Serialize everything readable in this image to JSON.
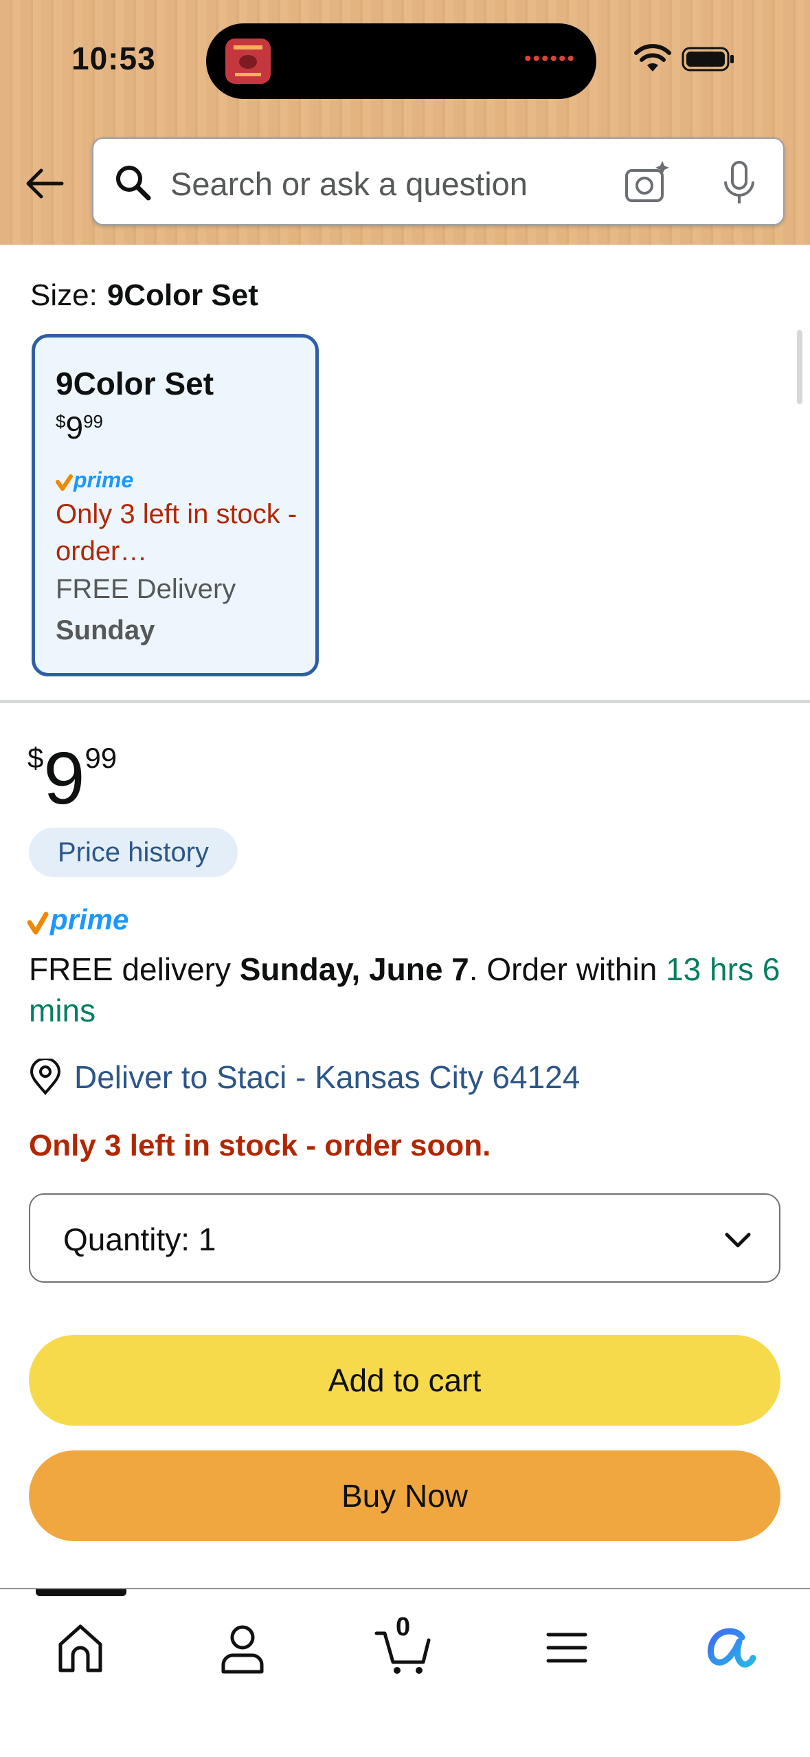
{
  "status_bar": {
    "time": "10:53"
  },
  "search": {
    "placeholder": "Search or ask a question"
  },
  "size": {
    "label": "Size:",
    "selected": "9Color Set",
    "option": {
      "title": "9Color Set",
      "price_currency": "$",
      "price_whole": "9",
      "price_fraction": "99",
      "stock": "Only 3 left in stock - order…",
      "delivery": "FREE Delivery",
      "delivery_day": "Sunday"
    }
  },
  "price": {
    "currency": "$",
    "whole": "9",
    "fraction": "99",
    "history_label": "Price history"
  },
  "delivery": {
    "prefix": "FREE delivery ",
    "date": "Sunday, June 7",
    "middle": ". Order within ",
    "countdown": "13 hrs 6 mins"
  },
  "deliver_to": "Deliver to Staci - Kansas City 64124",
  "stock_warning": "Only 3 left in stock - order soon.",
  "quantity": {
    "label": "Quantity:",
    "value": "1"
  },
  "buttons": {
    "add_to_cart": "Add to cart",
    "buy_now": "Buy Now"
  },
  "bottom_nav": {
    "cart_count": "0"
  },
  "colors": {
    "prime_blue": "#1a98ff",
    "prime_check": "#f08804",
    "deal_red": "#b12704",
    "link_blue": "#2c5688",
    "delivery_green": "#067d62",
    "add_to_cart_yellow": "#f7da4b",
    "buy_now_orange": "#f1a740"
  },
  "icons": [
    "back-arrow-icon",
    "search-icon",
    "camera-icon",
    "mic-icon",
    "prime-logo",
    "location-pin-icon",
    "chevron-down-icon",
    "home-icon",
    "account-icon",
    "cart-icon",
    "menu-icon",
    "rufus-ai-icon"
  ]
}
